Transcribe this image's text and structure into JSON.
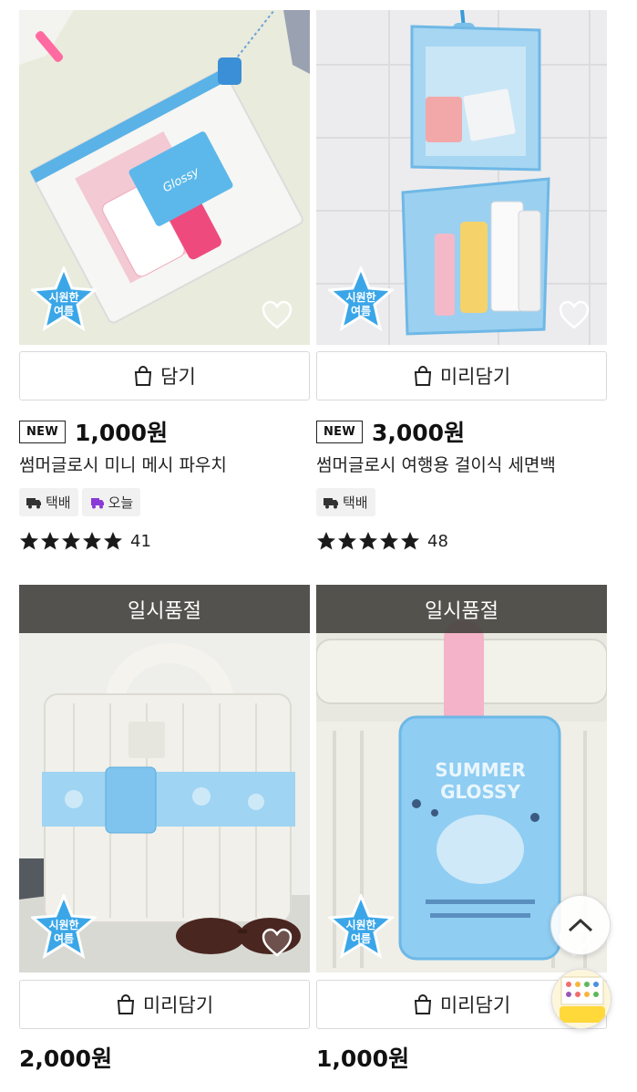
{
  "products": [
    {
      "add_label": "담기",
      "is_new": true,
      "new_label": "NEW",
      "price": "1,000원",
      "name": "썸머글로시 미니 메시 파우치",
      "tags": [
        {
          "icon": "truck-icon",
          "label": "택배"
        },
        {
          "icon": "fast-truck-icon",
          "label": "오늘"
        }
      ],
      "rating_stars": 5,
      "review_count": "41",
      "badge_text_top": "시원한",
      "badge_text_bottom": "여름"
    },
    {
      "add_label": "미리담기",
      "is_new": true,
      "new_label": "NEW",
      "price": "3,000원",
      "name": "썸머글로시 여행용 걸이식 세면백",
      "tags": [
        {
          "icon": "truck-icon",
          "label": "택배"
        }
      ],
      "rating_stars": 5,
      "review_count": "48",
      "badge_text_top": "시원한",
      "badge_text_bottom": "여름"
    },
    {
      "soldout_label": "일시품절",
      "add_label": "미리담기",
      "price": "2,000원",
      "badge_text_top": "시원한",
      "badge_text_bottom": "여름"
    },
    {
      "soldout_label": "일시품절",
      "add_label": "미리담기",
      "price": "1,000원",
      "badge_text_top": "시원한",
      "badge_text_bottom": "여름"
    }
  ],
  "colors": {
    "badge_blue": "#3aa6e8",
    "soldout_bg": "#46443f",
    "star": "#1a1a1a"
  },
  "floating": {
    "scroll_top_icon": "chevron-up-icon"
  }
}
